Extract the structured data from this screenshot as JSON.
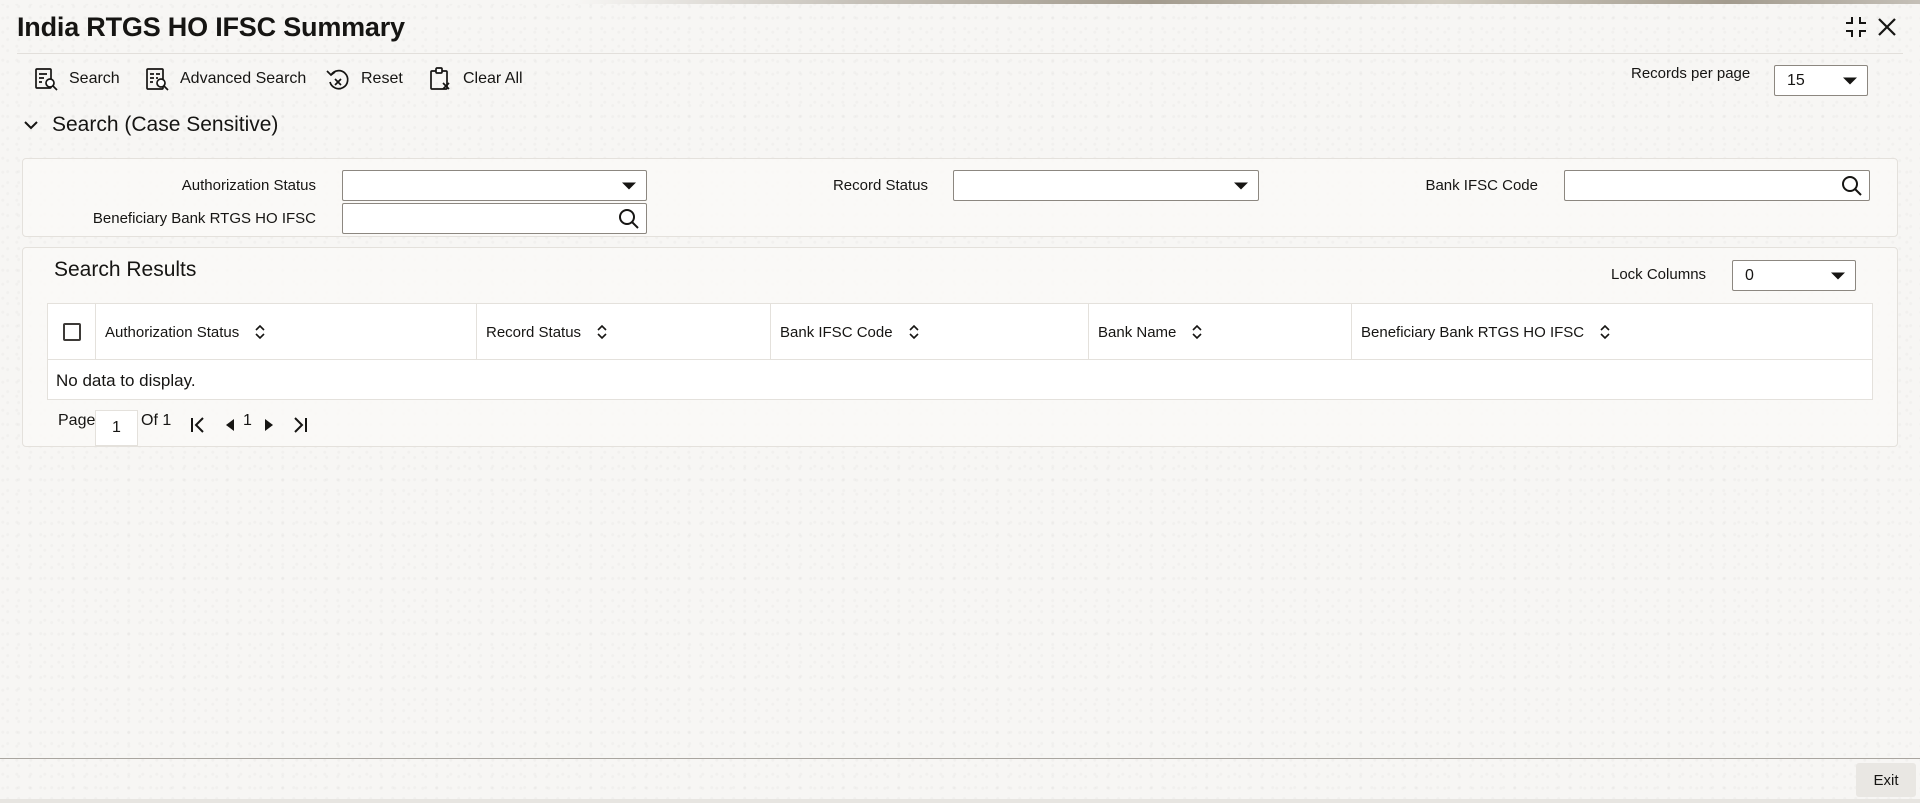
{
  "window": {
    "title": "India RTGS HO IFSC Summary"
  },
  "toolbar": {
    "search_label": "Search",
    "advanced_search_label": "Advanced Search",
    "reset_label": "Reset",
    "clear_all_label": "Clear All",
    "records_per_page_label": "Records per page",
    "records_per_page_value": "15"
  },
  "search_section": {
    "title": "Search (Case Sensitive)",
    "fields": {
      "authorization_status_label": "Authorization Status",
      "authorization_status_value": "",
      "record_status_label": "Record Status",
      "record_status_value": "",
      "bank_ifsc_code_label": "Bank IFSC Code",
      "bank_ifsc_code_value": "",
      "beneficiary_label": "Beneficiary Bank RTGS HO IFSC",
      "beneficiary_value": ""
    }
  },
  "results": {
    "title": "Search Results",
    "lock_columns_label": "Lock Columns",
    "lock_columns_value": "0",
    "columns": [
      "Authorization Status",
      "Record Status",
      "Bank IFSC Code",
      "Bank Name",
      "Beneficiary Bank RTGS HO IFSC"
    ],
    "empty_message": "No data to display."
  },
  "pagination": {
    "page_label": "Page",
    "current_page": "1",
    "of_label": "Of 1",
    "page_number": "1"
  },
  "footer": {
    "exit_label": "Exit"
  }
}
